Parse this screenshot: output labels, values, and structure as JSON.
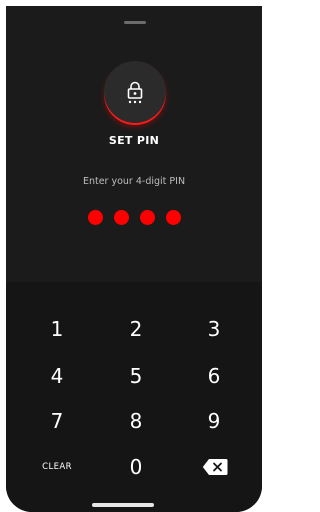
{
  "title": "SET PIN",
  "subtitle": "Enter your 4-digit PIN",
  "pin": {
    "length": 4,
    "entered": 4,
    "dot_color": "#ff0000"
  },
  "keypad": {
    "keys": [
      "1",
      "2",
      "3",
      "4",
      "5",
      "6",
      "7",
      "8",
      "9",
      "0"
    ],
    "clear_label": "CLEAR",
    "backspace_icon": "backspace-icon"
  },
  "icons": {
    "lock": "lock-keypad-icon"
  },
  "colors": {
    "accent": "#ff0000",
    "background": "#161616",
    "text": "#ffffff"
  }
}
